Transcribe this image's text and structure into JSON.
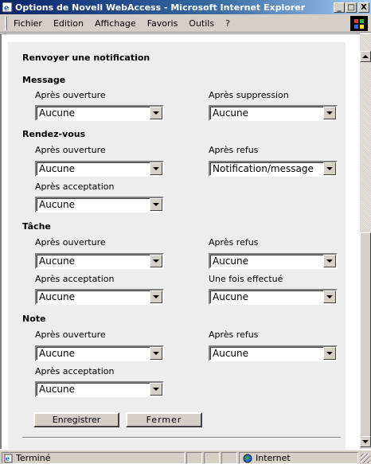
{
  "window": {
    "title": "Options de Novell WebAccess - Microsoft Internet Explorer",
    "minimize": "_",
    "maximize": "□",
    "close": "X"
  },
  "menu": {
    "items": [
      "Fichier",
      "Edition",
      "Affichage",
      "Favoris",
      "Outils",
      "?"
    ]
  },
  "page": {
    "heading": "Renvoyer une notification",
    "sections": [
      {
        "title": "Message",
        "fields": [
          {
            "label": "Après ouverture",
            "value": "Aucune"
          },
          {
            "label": "Après suppression",
            "value": "Aucune"
          }
        ]
      },
      {
        "title": "Rendez-vous",
        "fields": [
          {
            "label": "Après ouverture",
            "value": "Aucune"
          },
          {
            "label": "Après refus",
            "value": "Notification/message"
          },
          {
            "label": "Après acceptation",
            "value": "Aucune"
          }
        ]
      },
      {
        "title": "Tâche",
        "fields": [
          {
            "label": "Après ouverture",
            "value": "Aucune"
          },
          {
            "label": "Après refus",
            "value": "Aucune"
          },
          {
            "label": "Après acceptation",
            "value": "Aucune"
          },
          {
            "label": "Une fois effectué",
            "value": "Aucune"
          }
        ]
      },
      {
        "title": "Note",
        "fields": [
          {
            "label": "Après ouverture",
            "value": "Aucune"
          },
          {
            "label": "Après refus",
            "value": "Aucune"
          },
          {
            "label": "Après acceptation",
            "value": "Aucune"
          }
        ]
      }
    ],
    "buttons": {
      "save": "Enregistrer",
      "close": "Fermer"
    }
  },
  "status": {
    "text": "Terminé",
    "zone": "Internet"
  },
  "icons": {
    "app": "ie-document-icon",
    "brand": "windows-logo-icon",
    "status_page": "page-icon",
    "zone": "globe-icon"
  },
  "colors": {
    "titlebar_start": "#0a246a",
    "titlebar_end": "#a6caf0",
    "chrome": "#d4d0c8",
    "panel": "#ededed"
  }
}
